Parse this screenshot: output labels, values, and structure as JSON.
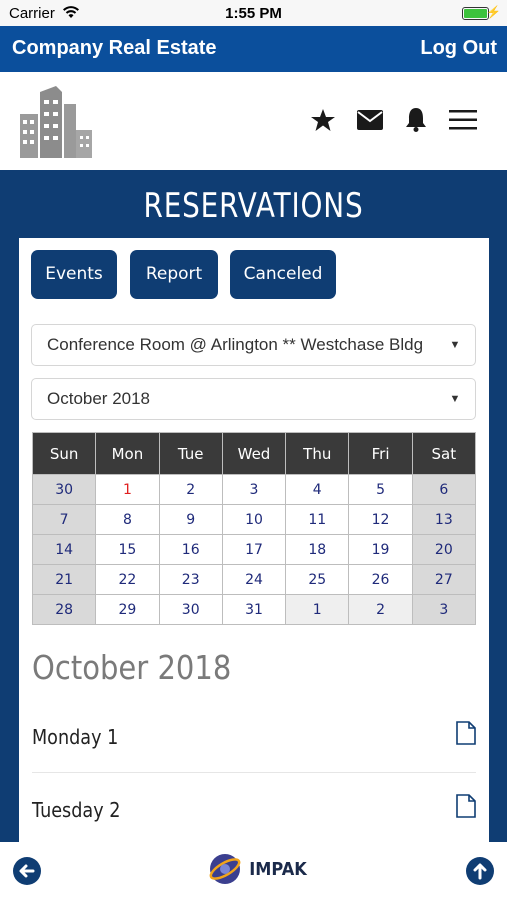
{
  "status_bar": {
    "carrier": "Carrier",
    "time": "1:55 PM"
  },
  "header": {
    "title": "Company Real Estate",
    "logout_label": "Log Out"
  },
  "nav_icons": [
    "star-icon",
    "envelope-icon",
    "bell-icon",
    "hamburger-menu-icon"
  ],
  "page": {
    "title": "RESERVATIONS"
  },
  "buttons": {
    "events": "Events",
    "report": "Report",
    "canceled": "Canceled"
  },
  "room_select": {
    "value": "Conference Room @ Arlington ** Westchase Bldg"
  },
  "month_select": {
    "value": "October 2018"
  },
  "calendar": {
    "weekdays": [
      "Sun",
      "Mon",
      "Tue",
      "Wed",
      "Thu",
      "Fri",
      "Sat"
    ],
    "weeks": [
      [
        "30",
        "1",
        "2",
        "3",
        "4",
        "5",
        "6"
      ],
      [
        "7",
        "8",
        "9",
        "10",
        "11",
        "12",
        "13"
      ],
      [
        "14",
        "15",
        "16",
        "17",
        "18",
        "19",
        "20"
      ],
      [
        "21",
        "22",
        "23",
        "24",
        "25",
        "26",
        "27"
      ],
      [
        "28",
        "29",
        "30",
        "31",
        "1",
        "2",
        "3"
      ]
    ],
    "highlight_color": "#e02020",
    "header_bg": "#3a3a3a",
    "weekend_bg": "#d9d9d9"
  },
  "list": {
    "month_heading": "October 2018",
    "days": [
      {
        "label": "Monday 1"
      },
      {
        "label": "Tuesday 2"
      }
    ]
  },
  "footer": {
    "brand": "IMPAK"
  },
  "colors": {
    "header_blue": "#0b4f9c",
    "navy": "#0f3d73"
  }
}
